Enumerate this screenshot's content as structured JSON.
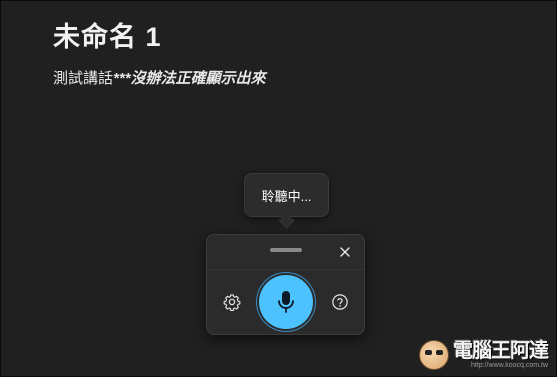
{
  "document": {
    "title": "未命名 1",
    "body_plain": "測試講話",
    "body_emphasis": "***沒辦法正確顯示出來"
  },
  "voice_typing": {
    "status_tooltip": "聆聽中...",
    "close_icon": "close-icon",
    "settings_icon": "gear-icon",
    "mic_icon": "microphone-icon",
    "help_icon": "help-circle-icon",
    "mic_color": "#4cc2ff",
    "state": "listening"
  },
  "watermark": {
    "title": "電腦王阿達",
    "url": "http://www.koocq.com.tw"
  }
}
